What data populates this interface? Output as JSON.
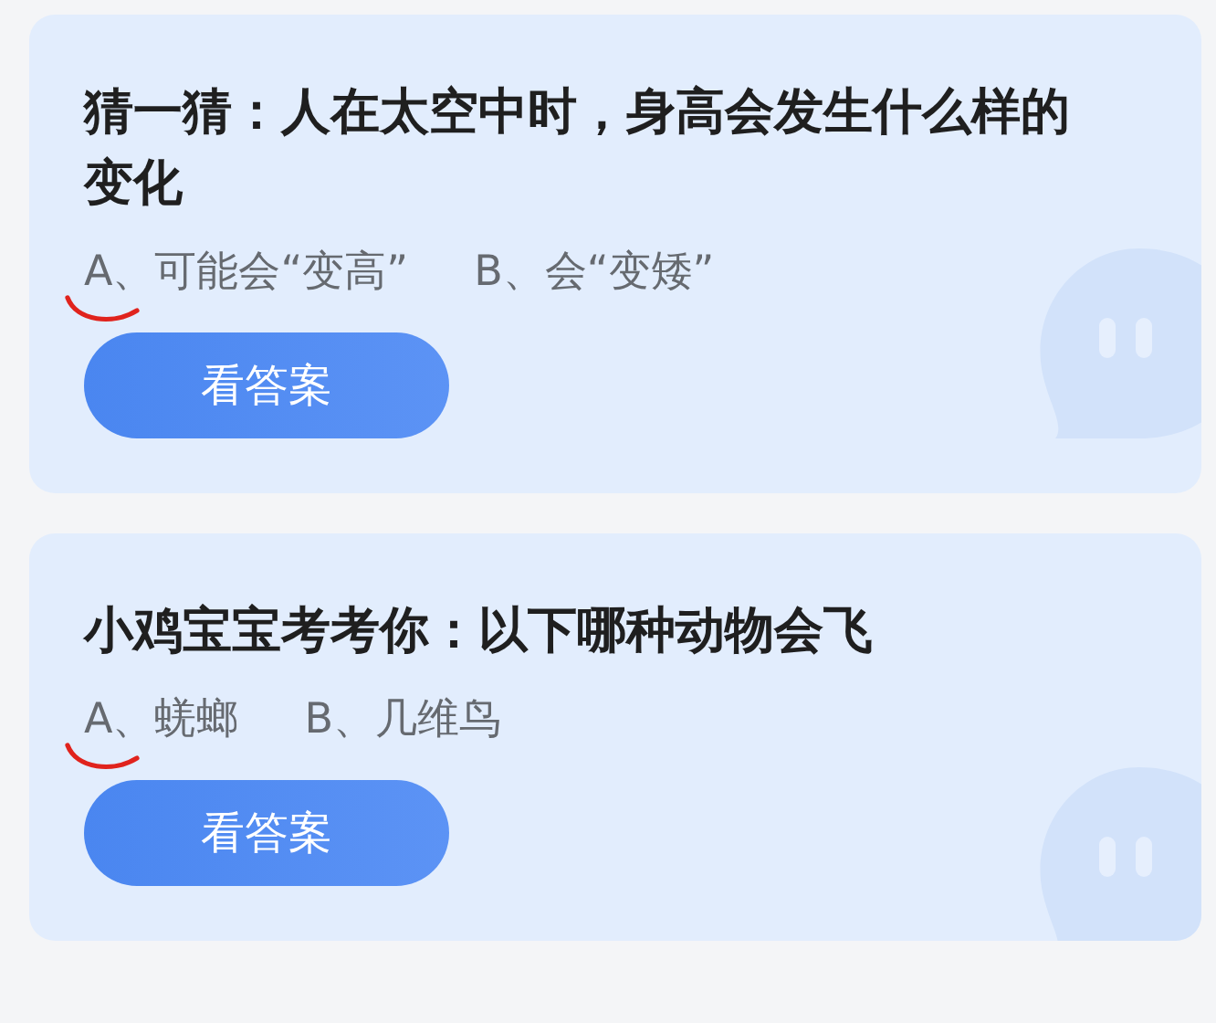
{
  "cards": [
    {
      "title": "猜一猜：人在太空中时，身高会发生什么样的变化",
      "options": [
        "A、可能会“变高”",
        "B、会“变矮”"
      ],
      "button": "看答案"
    },
    {
      "title": "小鸡宝宝考考你：以下哪种动物会飞",
      "options": [
        "A、蜣螂",
        "B、几维鸟"
      ],
      "button": "看答案"
    }
  ]
}
